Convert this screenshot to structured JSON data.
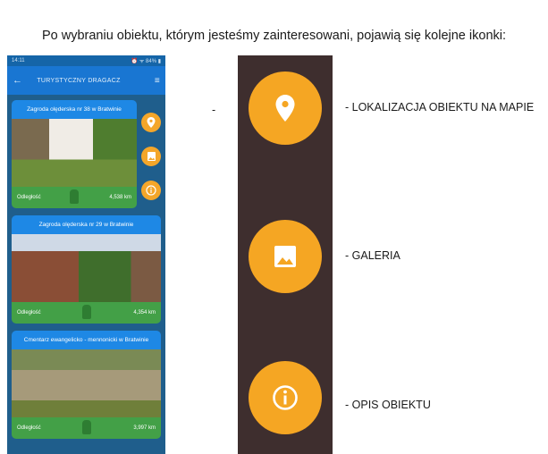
{
  "heading": "Po wybraniu obiektu, którym jesteśmy zainteresowani, pojawią się kolejne ikonki:",
  "phone": {
    "status_time": "14:11",
    "status_right": "⏰ ᯤ 84% ▮",
    "app_title": "TURYSTYCZNY DRAGACZ",
    "cards": [
      {
        "title": "Zagroda olęderska nr 38 w Bratwinie",
        "distance_label": "Odległość",
        "distance": "4,538 km"
      },
      {
        "title": "Zagroda olęderska nr 29 w Bratwinie",
        "distance_label": "Odległość",
        "distance": "4,354 km"
      },
      {
        "title": "Cmentarz ewangelicko - mennonicki w Bratwinie",
        "distance_label": "Odległość",
        "distance": "3,997 km"
      }
    ]
  },
  "legend": {
    "dash": "-",
    "items": [
      {
        "label": "- LOKALIZACJA OBIEKTU NA MAPIE",
        "icon": "location-pin-icon"
      },
      {
        "label": "- GALERIA",
        "icon": "gallery-image-icon"
      },
      {
        "label": "- OPIS OBIEKTU",
        "icon": "info-icon"
      }
    ]
  },
  "colors": {
    "accent": "#f5a623",
    "appbar": "#1976d2",
    "card_footer": "#43a047",
    "strip": "#3e2e2e"
  }
}
